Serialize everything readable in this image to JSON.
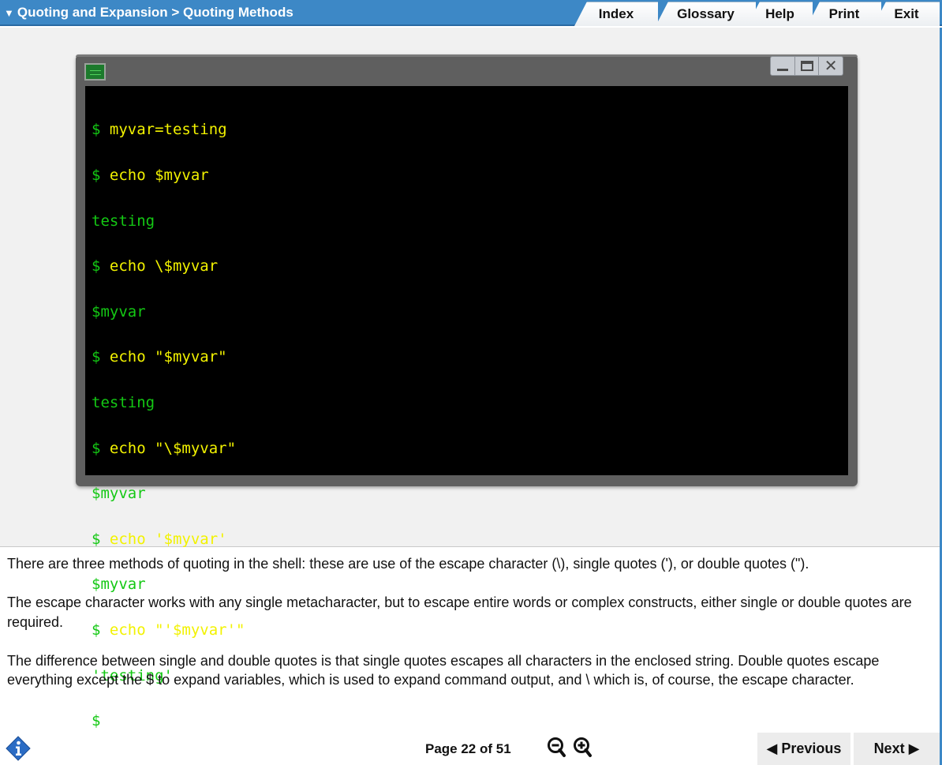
{
  "header": {
    "breadcrumb": "Quoting and Expansion > Quoting Methods",
    "tabs": [
      {
        "label": "Index"
      },
      {
        "label": "Glossary"
      },
      {
        "label": "Help"
      },
      {
        "label": "Print"
      },
      {
        "label": "Exit"
      }
    ]
  },
  "terminal": {
    "lines": [
      {
        "type": "cmd",
        "prompt": "$",
        "text": " myvar=testing"
      },
      {
        "type": "cmd",
        "prompt": "$",
        "text": " echo $myvar"
      },
      {
        "type": "out",
        "text": "testing"
      },
      {
        "type": "cmd",
        "prompt": "$",
        "text": " echo \\$myvar"
      },
      {
        "type": "out",
        "text": "$myvar"
      },
      {
        "type": "cmd",
        "prompt": "$",
        "text": " echo \"$myvar\""
      },
      {
        "type": "out",
        "text": "testing"
      },
      {
        "type": "cmd",
        "prompt": "$",
        "text": " echo \"\\$myvar\""
      },
      {
        "type": "out",
        "text": "$myvar"
      },
      {
        "type": "cmd",
        "prompt": "$",
        "text": " echo '$myvar'"
      },
      {
        "type": "out",
        "text": "$myvar"
      },
      {
        "type": "cmd",
        "prompt": "$",
        "text": " echo \"'$myvar'\""
      },
      {
        "type": "out",
        "text": "'testing'"
      },
      {
        "type": "cmd",
        "prompt": "$",
        "text": ""
      }
    ]
  },
  "content": {
    "paragraphs": [
      "There are three methods of quoting in the shell: these are use of the escape character (\\), single quotes ('), or double quotes (\").",
      "The escape character works with any single metacharacter, but to escape entire words or complex constructs, either single or double quotes are required.",
      "The difference between single and double quotes is that single quotes escapes all characters in the enclosed string. Double quotes escape everything except the $ to expand variables, which is used to expand command output, and \\ which is, of course, the escape character."
    ]
  },
  "footer": {
    "page_label": "Page 22 of 51",
    "previous_label": "◀ Previous",
    "next_label": "Next ▶"
  },
  "colors": {
    "header_blue": "#3d88c6",
    "prompt_green": "#14c814",
    "command_yellow": "#f2f200",
    "info_blue": "#2b6cc4"
  }
}
